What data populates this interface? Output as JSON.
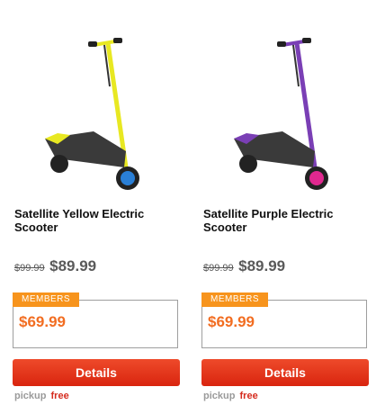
{
  "products": [
    {
      "name": "Satellite Yellow Electric Scooter",
      "old_price": "$99.99",
      "price": "$89.99",
      "members_label": "MEMBERS",
      "members_price": "$69.99",
      "details_label": "Details",
      "pickup_label": "pickup",
      "pickup_value": "free",
      "scooter_color": "#e8e822",
      "wheel_color": "#2a7fd6"
    },
    {
      "name": "Satellite Purple Electric Scooter",
      "old_price": "$99.99",
      "price": "$89.99",
      "members_label": "MEMBERS",
      "members_price": "$69.99",
      "details_label": "Details",
      "pickup_label": "pickup",
      "pickup_value": "free",
      "scooter_color": "#7a3fb5",
      "wheel_color": "#e0288f"
    }
  ],
  "colors": {
    "members_accent": "#f7941d",
    "members_price": "#f26d21",
    "button_red": "#e5331b",
    "pickup_free": "#d52b1e"
  }
}
